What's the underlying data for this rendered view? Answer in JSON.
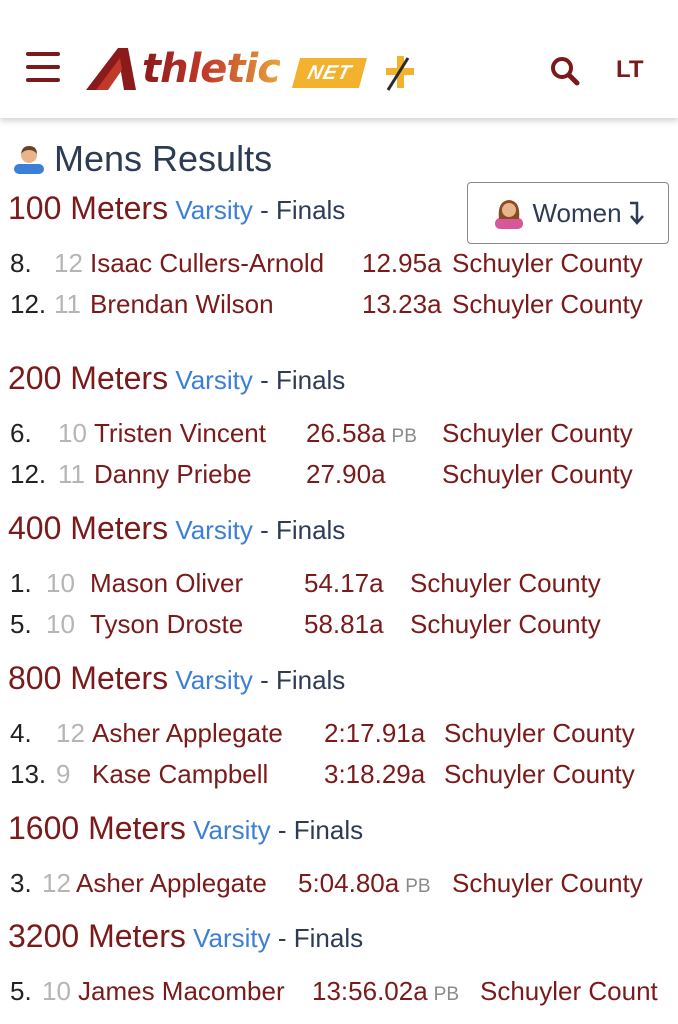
{
  "header": {
    "logo_text": "thletic",
    "logo_net": "NET",
    "logo_plus": "+",
    "user_initials": "LT",
    "icons": [
      "hamburger-icon",
      "search-icon"
    ],
    "brand_color": "#7a1a1a",
    "accent_color": "#f2b22e"
  },
  "page": {
    "title": "Mens Results",
    "toggle_label": "Women"
  },
  "level_color": "#3b7fd6",
  "events": [
    {
      "name": "100 Meters",
      "level": "Varsity",
      "sep": " - ",
      "round": "Finals",
      "results": [
        {
          "place": "8.",
          "grade": "12",
          "athlete": "Isaac Cullers-Arnold",
          "mark": "12.95a",
          "pb": "",
          "team": "Schuyler County"
        },
        {
          "place": "12.",
          "grade": "11",
          "athlete": "Brendan Wilson",
          "mark": "13.23a",
          "pb": "",
          "team": "Schuyler County"
        }
      ]
    },
    {
      "name": "200 Meters",
      "level": "Varsity",
      "sep": " - ",
      "round": "Finals",
      "results": [
        {
          "place": "6.",
          "grade": "10",
          "athlete": "Tristen Vincent",
          "mark": "26.58a",
          "pb": "PB",
          "team": "Schuyler County"
        },
        {
          "place": "12.",
          "grade": "11",
          "athlete": "Danny Priebe",
          "mark": "27.90a",
          "pb": "",
          "team": "Schuyler County"
        }
      ]
    },
    {
      "name": "400 Meters",
      "level": "Varsity",
      "sep": " - ",
      "round": "Finals",
      "results": [
        {
          "place": "1.",
          "grade": "10",
          "athlete": "Mason Oliver",
          "mark": "54.17a",
          "pb": "",
          "team": "Schuyler County"
        },
        {
          "place": "5.",
          "grade": "10",
          "athlete": "Tyson Droste",
          "mark": "58.81a",
          "pb": "",
          "team": "Schuyler County"
        }
      ]
    },
    {
      "name": "800 Meters",
      "level": "Varsity",
      "sep": " - ",
      "round": "Finals",
      "results": [
        {
          "place": "4.",
          "grade": "12",
          "athlete": "Asher Applegate",
          "mark": "2:17.91a",
          "pb": "",
          "team": "Schuyler County"
        },
        {
          "place": "13.",
          "grade": "9",
          "athlete": "Kase Campbell",
          "mark": "3:18.29a",
          "pb": "",
          "team": "Schuyler County"
        }
      ]
    },
    {
      "name": "1600 Meters",
      "level": "Varsity",
      "sep": " - ",
      "round": "Finals",
      "results": [
        {
          "place": "3.",
          "grade": "12",
          "athlete": "Asher Applegate",
          "mark": "5:04.80a",
          "pb": "PB",
          "team": "Schuyler County"
        }
      ]
    },
    {
      "name": "3200 Meters",
      "level": "Varsity",
      "sep": " - ",
      "round": "Finals",
      "results": [
        {
          "place": "5.",
          "grade": "10",
          "athlete": "James Macomber",
          "mark": "13:56.02a",
          "pb": "PB",
          "team": "Schuyler Count"
        }
      ]
    }
  ]
}
